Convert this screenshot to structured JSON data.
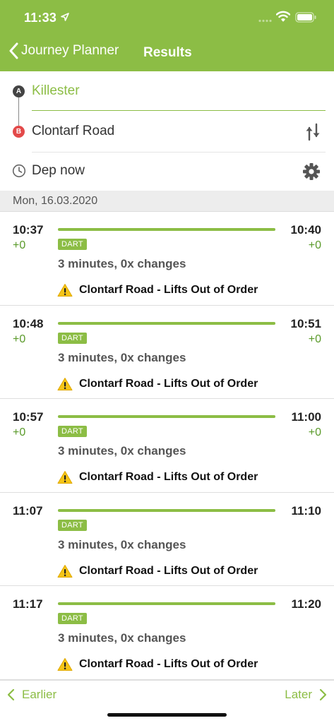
{
  "status_bar": {
    "time": "11:33"
  },
  "nav": {
    "back_label": "Journey Planner",
    "title": "Results"
  },
  "search": {
    "from_marker": "A",
    "to_marker": "B",
    "from": "Killester",
    "to": "Clontarf Road",
    "departure": "Dep now"
  },
  "date_label": "Mon, 16.03.2020",
  "results": [
    {
      "dep": "10:37",
      "arr": "10:40",
      "dep_delay": "+0",
      "arr_delay": "+0",
      "mode": "DART",
      "duration": "3 minutes,  0x changes",
      "warning": "Clontarf Road - Lifts Out of Order"
    },
    {
      "dep": "10:48",
      "arr": "10:51",
      "dep_delay": "+0",
      "arr_delay": "+0",
      "mode": "DART",
      "duration": "3 minutes,  0x changes",
      "warning": "Clontarf Road - Lifts Out of Order"
    },
    {
      "dep": "10:57",
      "arr": "11:00",
      "dep_delay": "+0",
      "arr_delay": "+0",
      "mode": "DART",
      "duration": "3 minutes,  0x changes",
      "warning": "Clontarf Road - Lifts Out of Order"
    },
    {
      "dep": "11:07",
      "arr": "11:10",
      "dep_delay": "",
      "arr_delay": "",
      "mode": "DART",
      "duration": "3 minutes,  0x changes",
      "warning": "Clontarf Road - Lifts Out of Order"
    },
    {
      "dep": "11:17",
      "arr": "11:20",
      "dep_delay": "",
      "arr_delay": "",
      "mode": "DART",
      "duration": "3 minutes,  0x changes",
      "warning": "Clontarf Road - Lifts Out of Order"
    }
  ],
  "bottom": {
    "earlier": "Earlier",
    "later": "Later"
  },
  "colors": {
    "accent": "#8cbd45",
    "delay": "#5a9a2a",
    "destination_marker": "#e34a4a",
    "warning": "#f5c518"
  }
}
